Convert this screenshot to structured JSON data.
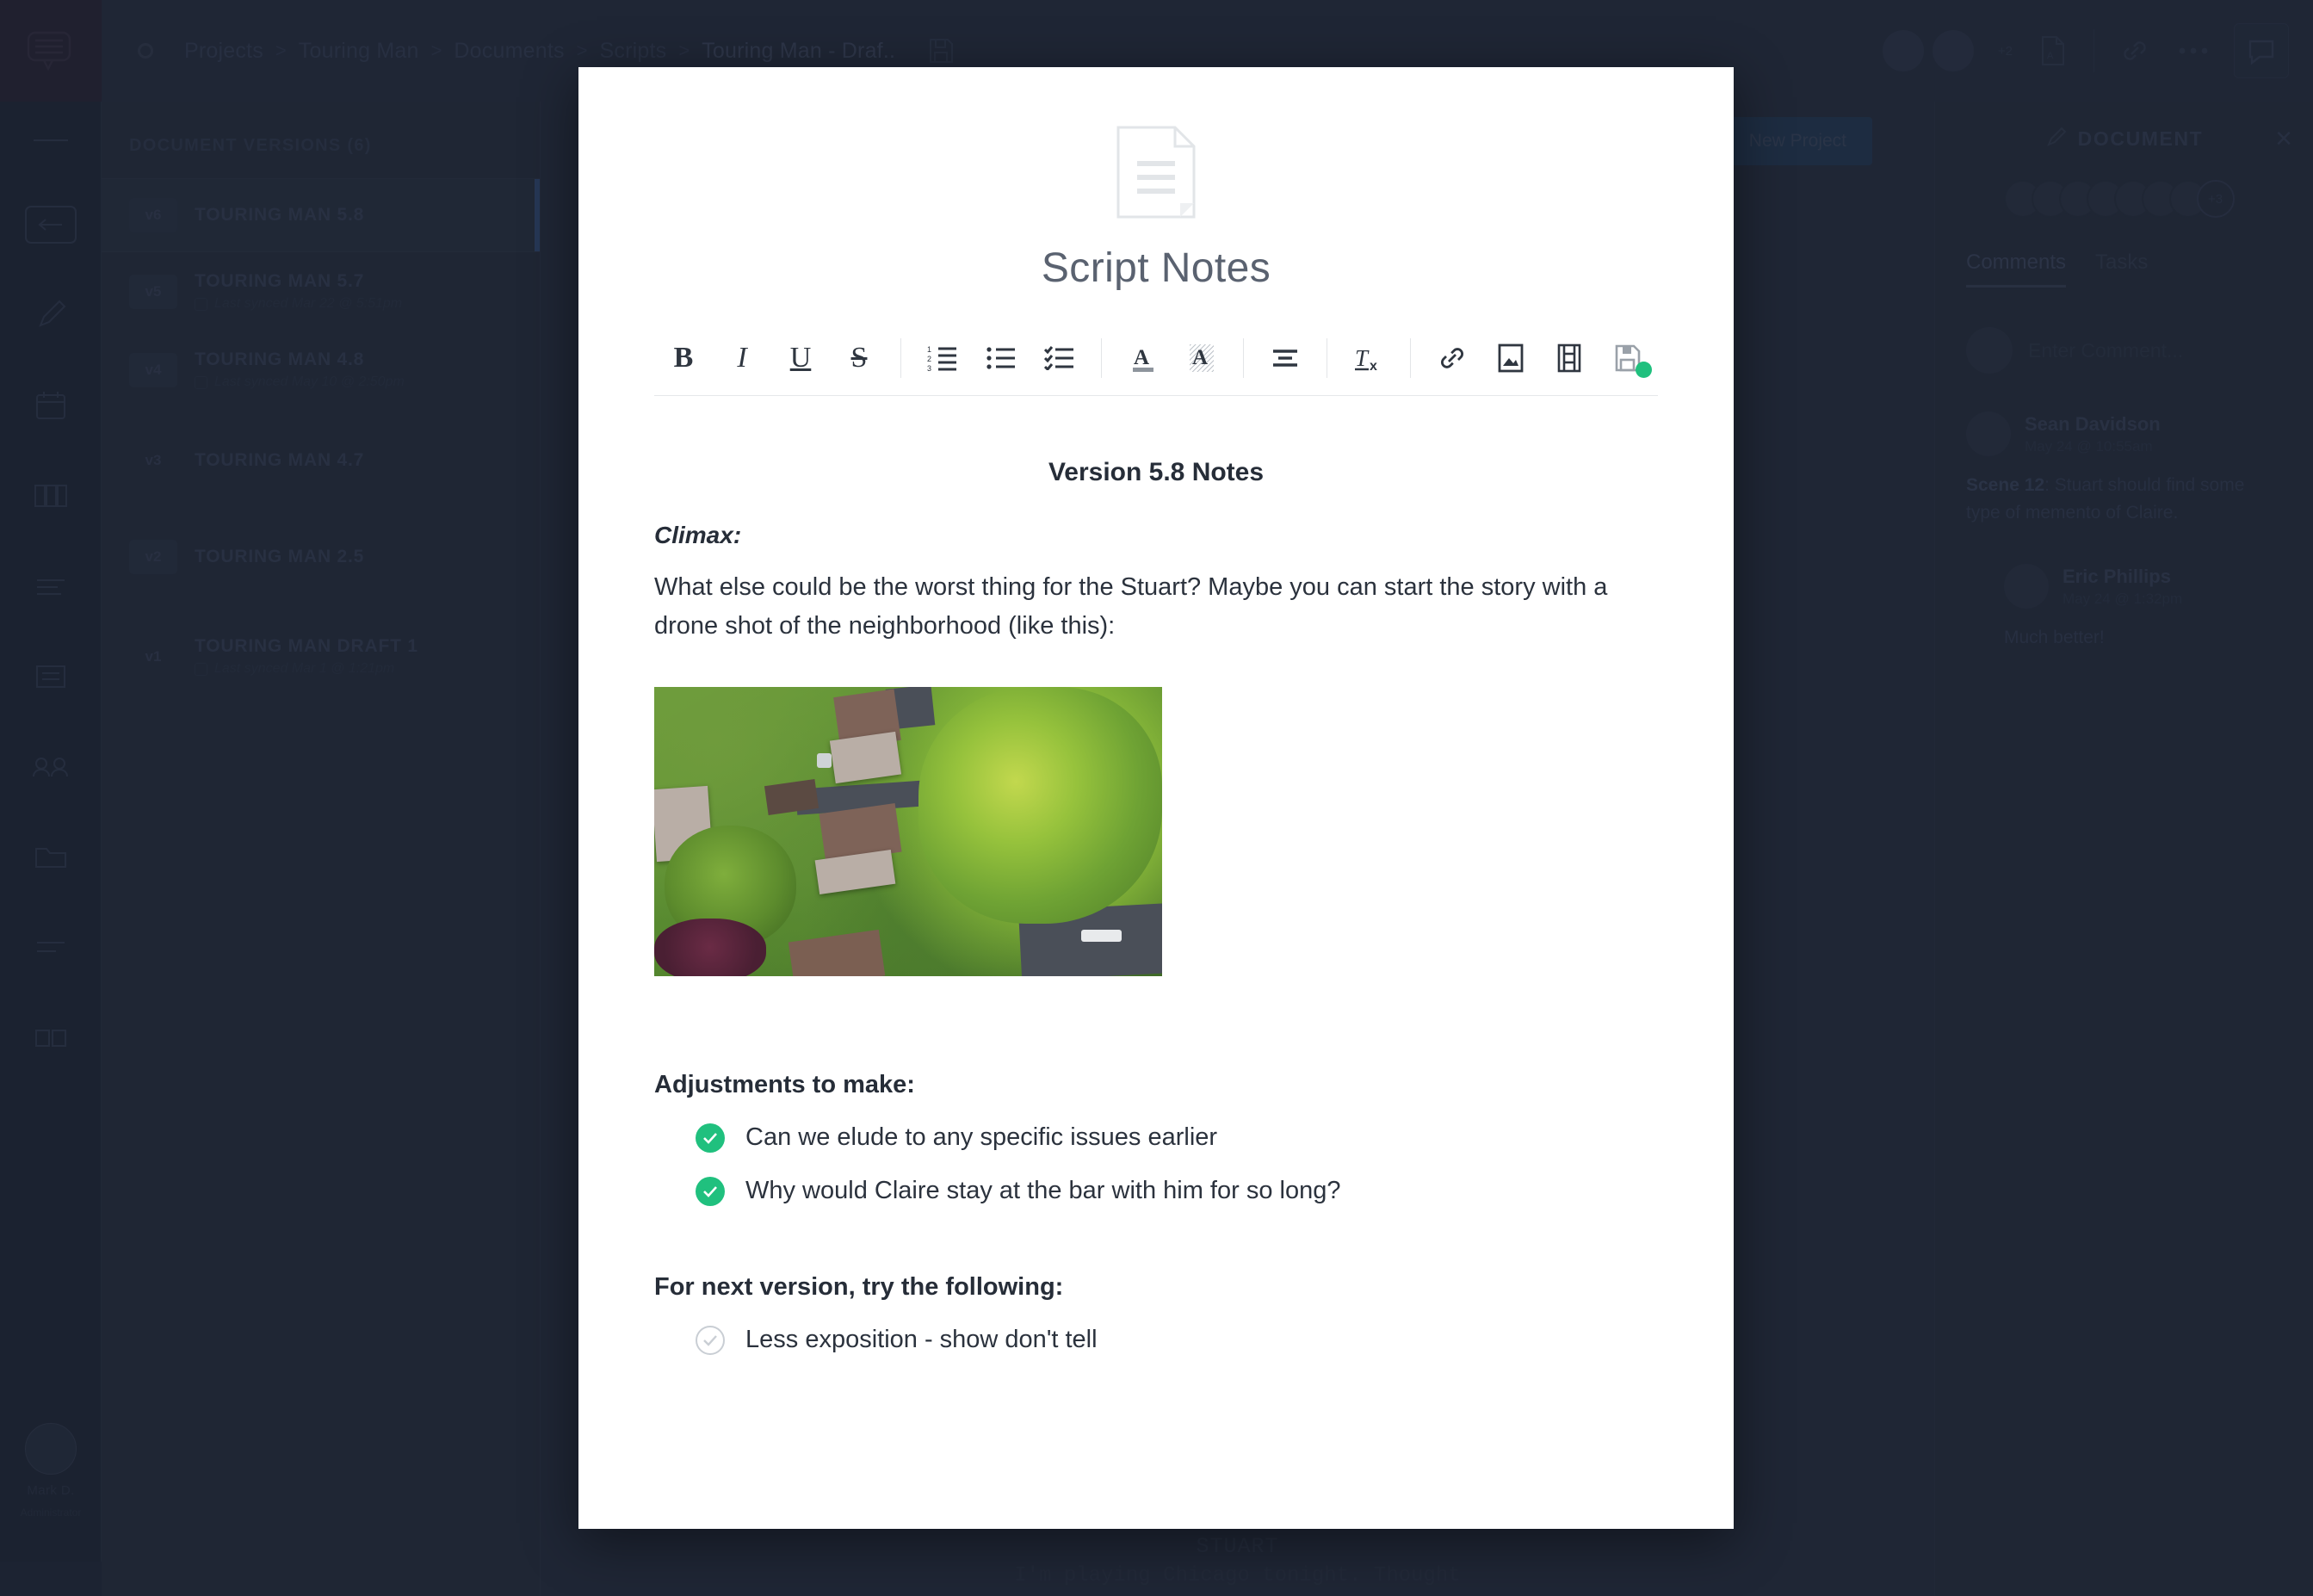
{
  "header": {
    "breadcrumb": [
      "Projects",
      "Touring Man",
      "Documents",
      "Scripts",
      "Touring Man - Draf.."
    ],
    "separator": ">",
    "icons": {
      "app_mark": "concentric-circles-logo",
      "save": "save-icon",
      "export_pdf": "pdf-export-icon",
      "link": "link-icon",
      "more": "more-horizontal-icon",
      "panel": "comment-panel-icon"
    },
    "avatar_count_label": "+2"
  },
  "icon_rail": {
    "logo": "speech-bubble-logo",
    "items": [
      {
        "name": "collapse-rail-icon",
        "label": ""
      },
      {
        "name": "projects-icon",
        "label": ""
      },
      {
        "name": "pencil-icon",
        "label": ""
      },
      {
        "name": "calendar-icon",
        "label": ""
      },
      {
        "name": "board-icon",
        "label": ""
      },
      {
        "name": "list-icon",
        "label": ""
      },
      {
        "name": "document-icon",
        "label": ""
      },
      {
        "name": "people-icon",
        "label": ""
      },
      {
        "name": "folder-icon",
        "label": ""
      },
      {
        "name": "chart-icon",
        "label": ""
      },
      {
        "name": "grid-icon",
        "label": ""
      }
    ],
    "user": {
      "name": "Mark D.",
      "role": "Administrator"
    }
  },
  "versions_pane": {
    "title": "DOCUMENT VERSIONS (6)",
    "items": [
      {
        "badge": "v6",
        "name": "TOURING MAN 5.8",
        "sync": "",
        "active": true
      },
      {
        "badge": "v5",
        "name": "TOURING MAN 5.7",
        "sync": "Last synced Mar 22 @ 5:51pm",
        "active": false
      },
      {
        "badge": "v4",
        "name": "TOURING MAN 4.8",
        "sync": "Last synced May 10 @ 2:50pm",
        "active": false
      },
      {
        "badge": "v3",
        "name": "TOURING MAN 4.7",
        "sync": "",
        "active": false
      },
      {
        "badge": "v2",
        "name": "TOURING MAN 2.5",
        "sync": "",
        "active": false
      },
      {
        "badge": "v1",
        "name": "TOURING MAN DRAFT 1",
        "sync": "Last synced Mar 1 @ 1:21pm",
        "active": false
      }
    ]
  },
  "doc_area": {
    "new_project_label": "New Project",
    "script_character": "STUART",
    "script_line": "I'm playing Chicago tonight. Thought"
  },
  "right_panel": {
    "title": "DOCUMENT",
    "pencil_icon": "pencil-icon",
    "close_icon": "close-icon",
    "avatar_overflow": "+3",
    "tabs": [
      {
        "label": "Comments",
        "active": true
      },
      {
        "label": "Tasks",
        "active": false
      }
    ],
    "comment_placeholder": "Enter Comment...",
    "comments": [
      {
        "author": "Sean Davidson",
        "time": "May 24 @ 10:55am",
        "body_bold": "Scene 12",
        "body_rest": ": Stuart should find some type of memento of Claire.",
        "reply": false
      },
      {
        "author": "Eric Phillips",
        "time": "May 24 @ 1:32pm",
        "body_bold": "",
        "body_rest": "Much better!",
        "reply": true
      }
    ]
  },
  "modal": {
    "doc_icon": "document-page-icon",
    "title": "Script Notes",
    "toolbar": [
      {
        "name": "bold-button",
        "glyph": "B",
        "cls": "b"
      },
      {
        "name": "italic-button",
        "glyph": "I",
        "cls": "i"
      },
      {
        "name": "underline-button",
        "glyph": "U",
        "cls": "u"
      },
      {
        "name": "strikethrough-button",
        "glyph": "S",
        "cls": "s"
      },
      {
        "name": "ordered-list-button",
        "glyph": "",
        "cls": "svg-ol"
      },
      {
        "name": "unordered-list-button",
        "glyph": "",
        "cls": "svg-ul"
      },
      {
        "name": "checklist-button",
        "glyph": "",
        "cls": "svg-cl"
      },
      {
        "name": "text-color-button",
        "glyph": "",
        "cls": "svg-tc"
      },
      {
        "name": "highlight-color-button",
        "glyph": "",
        "cls": "svg-hl"
      },
      {
        "name": "align-button",
        "glyph": "",
        "cls": "svg-al"
      },
      {
        "name": "clear-formatting-button",
        "glyph": "",
        "cls": "svg-cf"
      },
      {
        "name": "insert-link-button",
        "glyph": "",
        "cls": "svg-lk"
      },
      {
        "name": "insert-image-button",
        "glyph": "",
        "cls": "svg-im"
      },
      {
        "name": "insert-video-button",
        "glyph": "",
        "cls": "svg-vd"
      },
      {
        "name": "save-button",
        "glyph": "",
        "cls": "svg-sv"
      }
    ],
    "content": {
      "version_heading": "Version 5.8 Notes",
      "climax_label": "Climax:",
      "paragraph": "What else could be the worst thing for the Stuart? Maybe you can start the story with a drone shot of the neighborhood (like this):",
      "image_alt": "aerial drone photo of suburban neighborhood with houses and trees",
      "adjustments_heading": "Adjustments to make:",
      "adjustments": [
        {
          "text": "Can we elude to any specific issues earlier",
          "checked": true
        },
        {
          "text": "Why would Claire stay at the bar with him for so long?",
          "checked": true
        }
      ],
      "next_version_heading": "For next version, try the following:",
      "next_version": [
        {
          "text": "Less exposition - show don't tell",
          "checked": false
        }
      ]
    }
  },
  "colors": {
    "accent_green": "#20c07e",
    "app_bg": "#2b3446",
    "modal_bg": "#ffffff",
    "button_blue": "#27405f"
  }
}
